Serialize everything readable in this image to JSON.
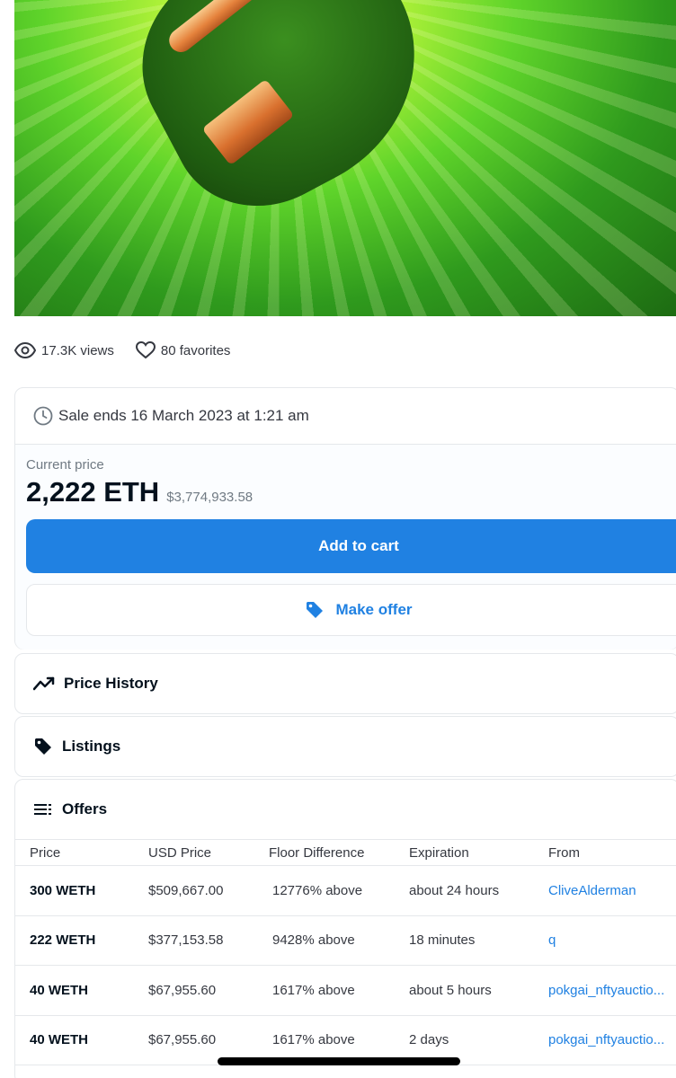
{
  "stats": {
    "views": "17.3K views",
    "favorites": "80 favorites"
  },
  "sale": {
    "ends_text": "Sale ends 16 March 2023 at 1:21 am",
    "current_price_label": "Current price",
    "price_eth": "2,222 ETH",
    "price_usd": "$3,774,933.58",
    "add_to_cart": "Add to cart",
    "make_offer": "Make offer"
  },
  "sections": {
    "price_history": "Price History",
    "listings": "Listings",
    "offers": "Offers"
  },
  "offers_table": {
    "headers": [
      "Price",
      "USD Price",
      "Floor Difference",
      "Expiration",
      "From"
    ],
    "rows": [
      [
        "300 WETH",
        "$509,667.00",
        "12776% above",
        "about 24 hours",
        "CliveAlderman"
      ],
      [
        "222 WETH",
        "$377,153.58",
        "9428% above",
        "18 minutes",
        "q"
      ],
      [
        "40 WETH",
        "$67,955.60",
        "1617% above",
        "about 5 hours",
        "pokgai_nftyauctio..."
      ],
      [
        "40 WETH",
        "$67,955.60",
        "1617% above",
        "2 days",
        "pokgai_nftyauctio..."
      ]
    ]
  },
  "colors": {
    "accent": "#2081e2",
    "text": "#04111d",
    "muted": "#707a83",
    "border": "#e5e8eb"
  }
}
